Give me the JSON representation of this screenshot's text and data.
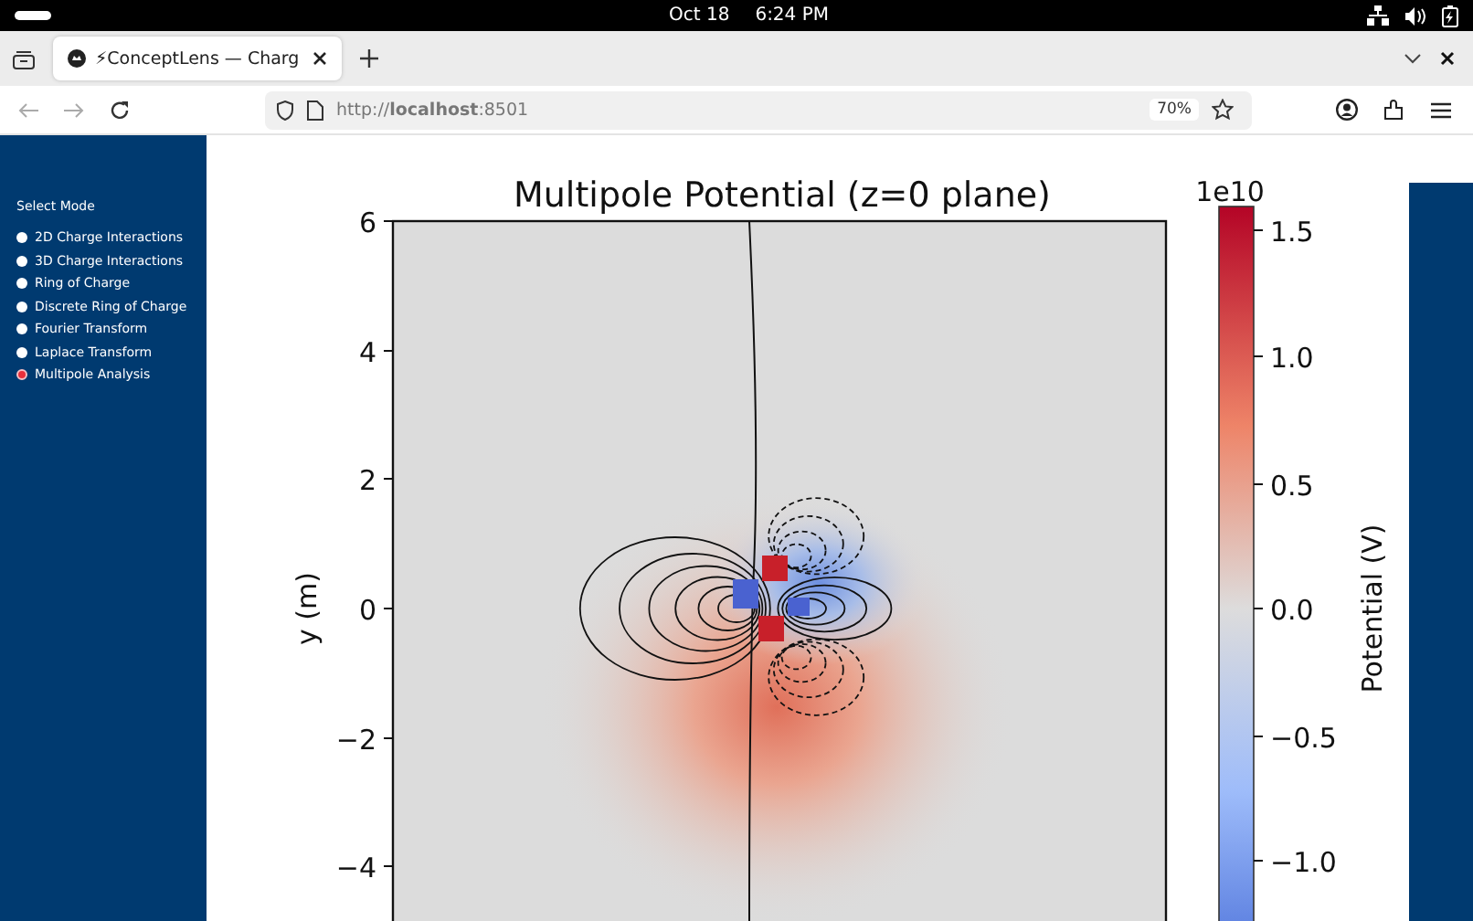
{
  "status_bar": {
    "date": "Oct 18",
    "time": "6:24 PM"
  },
  "tabs": [
    {
      "title": "⚡ConceptLens — Charg",
      "selected": true
    }
  ],
  "address_bar": {
    "url": "http://**localhost**:8501",
    "zoom": "70%"
  },
  "sidebar": {
    "title": "Select Mode",
    "items": [
      {
        "label": "2D Charge Interactions",
        "selected": false
      },
      {
        "label": "3D Charge Interactions",
        "selected": false
      },
      {
        "label": "Ring of Charge",
        "selected": false
      },
      {
        "label": "Discrete Ring of Charge",
        "selected": false
      },
      {
        "label": "Fourier Transform",
        "selected": false
      },
      {
        "label": "Laplace Transform",
        "selected": false
      },
      {
        "label": "Multipole Analysis",
        "selected": true
      }
    ]
  },
  "plot": {
    "title": "Multipole Potential (z=0 plane)",
    "ylabel": "y (m)",
    "yticks": [
      "6",
      "4",
      "2",
      "0",
      "−2",
      "−4"
    ],
    "colorbar": {
      "label": "Potential (V)",
      "offset": "1e10",
      "ticks": [
        "1.5",
        "1.0",
        "0.5",
        "0.0",
        "−0.5",
        "−1.0"
      ]
    }
  }
}
